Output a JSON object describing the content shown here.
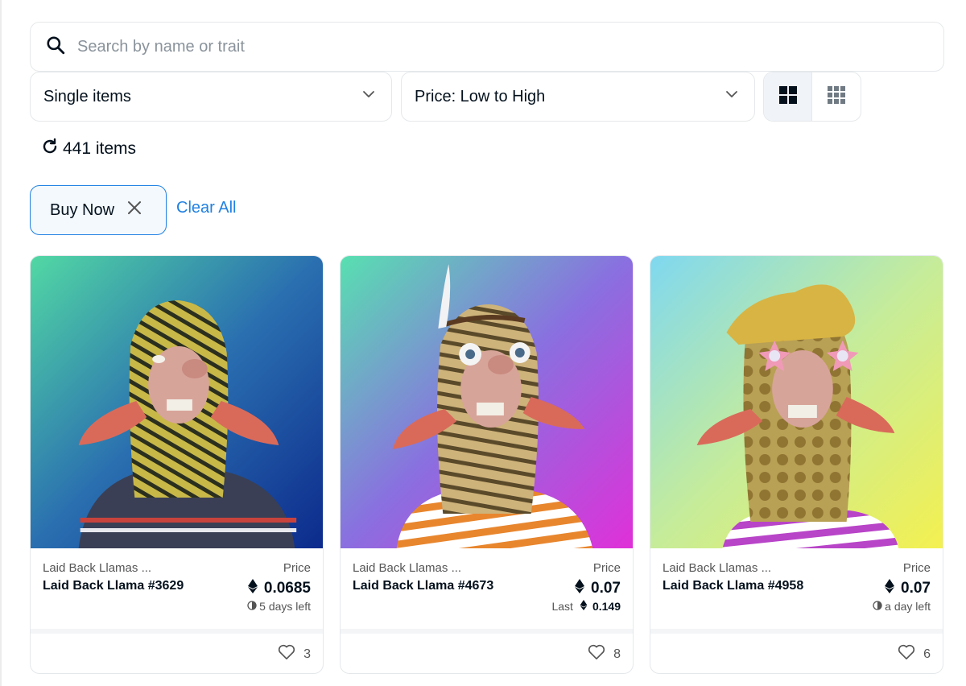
{
  "search": {
    "placeholder": "Search by name or trait",
    "icon": "search-icon"
  },
  "filters": {
    "type_select": {
      "value": "Single items"
    },
    "sort_select": {
      "value": "Price: Low to High"
    }
  },
  "view_toggle": {
    "options": [
      "large-grid-icon",
      "small-grid-icon"
    ],
    "active": "large-grid-icon"
  },
  "results": {
    "count_label": "441 items"
  },
  "active_filters": {
    "chips": [
      "Buy Now"
    ],
    "clear_all_label": "Clear All"
  },
  "colors": {
    "accent": "#2081e2",
    "text": "#04111d",
    "muted": "#555555",
    "border": "#e5e8eb"
  },
  "cards": [
    {
      "collection": "Laid Back Llamas ...",
      "name": "Laid Back Llama #3629",
      "price_label": "Price",
      "price": "0.0685",
      "sub": "5 days left",
      "likes": "3"
    },
    {
      "collection": "Laid Back Llamas ...",
      "name": "Laid Back Llama #4673",
      "price_label": "Price",
      "price": "0.07",
      "last_label": "Last",
      "last_price": "0.149",
      "likes": "8"
    },
    {
      "collection": "Laid Back Llamas ...",
      "name": "Laid Back Llama #4958",
      "price_label": "Price",
      "price": "0.07",
      "sub": "a day left",
      "likes": "6"
    }
  ]
}
